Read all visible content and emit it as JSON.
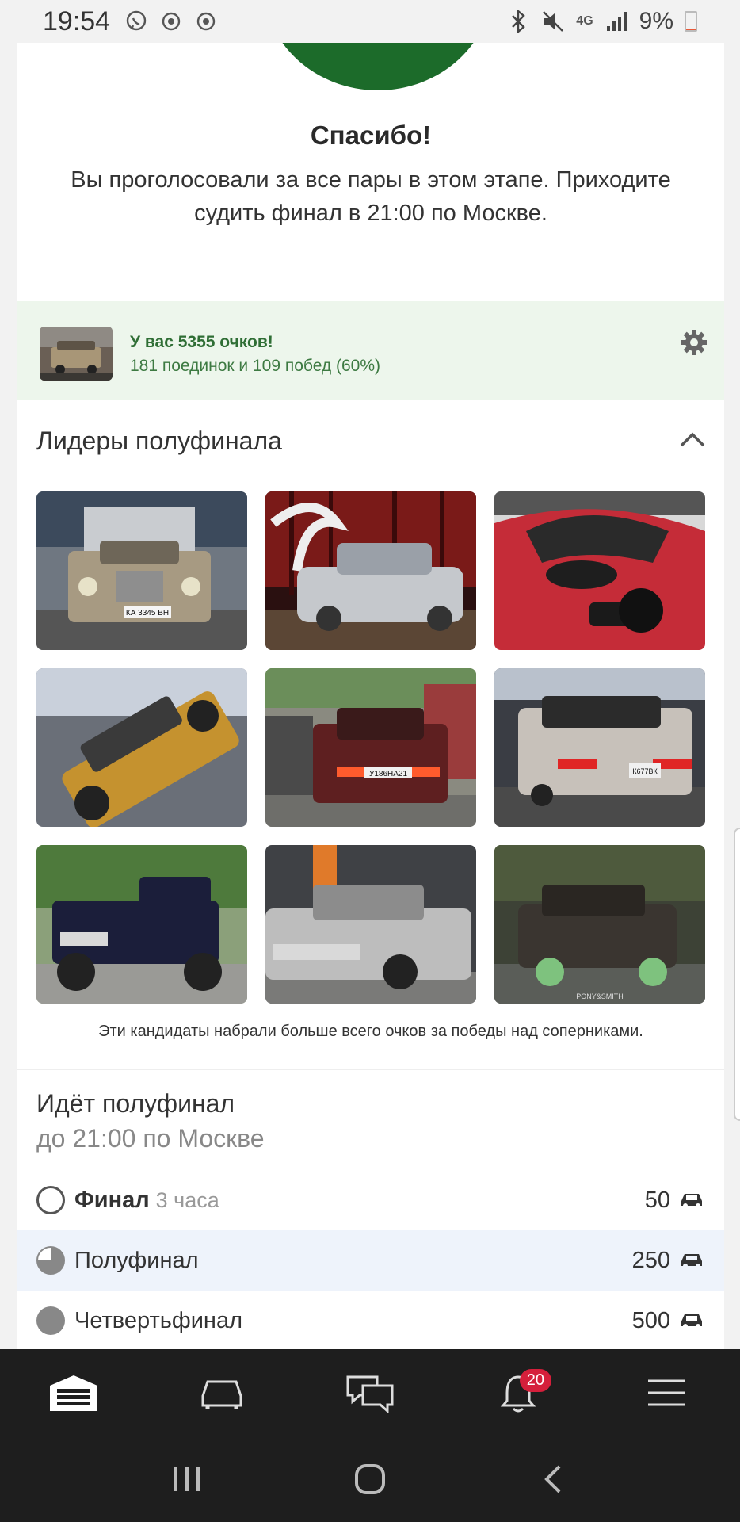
{
  "status_bar": {
    "time": "19:54",
    "network": "4G",
    "battery": "9%",
    "battery_level": 0.09
  },
  "thanks": {
    "title": "Спасибо!",
    "text": "Вы проголосовали за все пары в этом этапе. Приходите судить финал в 21:00 по Москве."
  },
  "score": {
    "title": "У вас 5355 очков!",
    "subtitle": "181 поединок и 109 побед (60%)"
  },
  "leaders": {
    "title": "Лидеры полуфинала",
    "caption": "Эти кандидаты набрали больше всего очков за победы над соперниками.",
    "items": [
      {
        "plate": "КА 3345 ВН"
      },
      {
        "plate": ""
      },
      {
        "plate": ""
      },
      {
        "plate": ""
      },
      {
        "plate": "У186НА21"
      },
      {
        "plate": "К677ВК"
      },
      {
        "plate": ""
      },
      {
        "plate": ""
      },
      {
        "plate": "PONY&SMITH"
      }
    ]
  },
  "stages": {
    "title": "Идёт полуфинал",
    "subtitle": "до 21:00 по Москве",
    "rows": [
      {
        "name": "Финал",
        "duration": "3 часа",
        "count": "50"
      },
      {
        "name": "Полуфинал",
        "duration": "",
        "count": "250"
      },
      {
        "name": "Четвертьфинал",
        "duration": "",
        "count": "500"
      }
    ]
  },
  "nav": {
    "notifications_badge": "20"
  },
  "colors": {
    "accent_green": "#1c6b2a",
    "score_bg": "#edf6ec",
    "badge_red": "#d51f3b",
    "active_row_bg": "#eef3fb"
  }
}
